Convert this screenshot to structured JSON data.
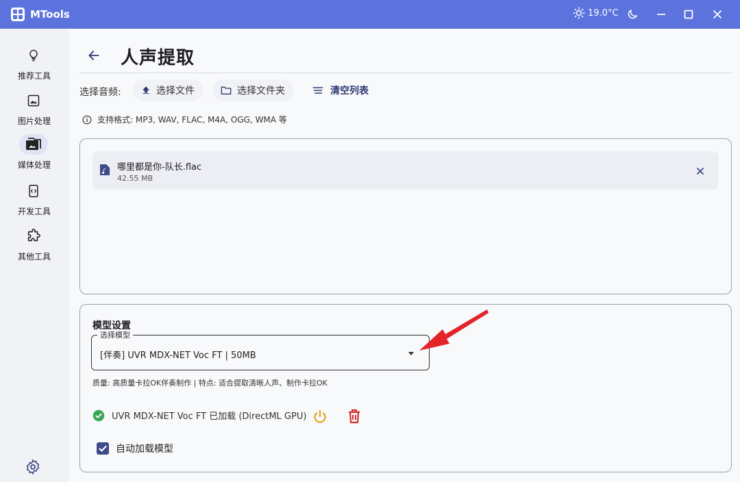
{
  "window": {
    "app_title": "MTools",
    "weather_temp": "19.0°C",
    "icons": [
      "app-logo-icon",
      "sun-icon",
      "moon-icon",
      "minimize-icon",
      "maximize-icon",
      "close-icon"
    ]
  },
  "sidebar": {
    "items": [
      {
        "label": "推荐工具",
        "icon": "lightbulb-icon",
        "active": false
      },
      {
        "label": "图片处理",
        "icon": "image-icon",
        "active": false
      },
      {
        "label": "媒体处理",
        "icon": "media-folder-icon",
        "active": true
      },
      {
        "label": "开发工具",
        "icon": "code-icon",
        "active": false
      },
      {
        "label": "其他工具",
        "icon": "puzzle-icon",
        "active": false
      }
    ],
    "settings_icon": "gear-icon"
  },
  "page": {
    "title": "人声提取"
  },
  "toolbar": {
    "label": "选择音频:",
    "select_file": "选择文件",
    "select_folder": "选择文件夹",
    "clear_list": "清空列表"
  },
  "hint": "支持格式: MP3, WAV, FLAC, M4A, OGG, WMA 等",
  "files": [
    {
      "name": "哪里都是你-队长.flac",
      "size": "42.55 MB"
    }
  ],
  "model": {
    "section_title": "模型设置",
    "select_label": "选择模型",
    "selected": "[伴奏] UVR MDX-NET Voc FT  |  50MB",
    "description": "质量: 高质量卡拉OK伴奏制作 | 特点: 适合提取清晰人声、制作卡拉OK",
    "status": "UVR MDX-NET Voc FT 已加载 (DirectML GPU)",
    "auto_load_label": "自动加载模型",
    "auto_load_checked": true
  },
  "colors": {
    "titlebar": "#5c73dd",
    "accent": "#3f4a8a",
    "success": "#3aa655",
    "power": "#e8a317",
    "danger": "#d32f2f",
    "arrow": "#e3242b"
  }
}
